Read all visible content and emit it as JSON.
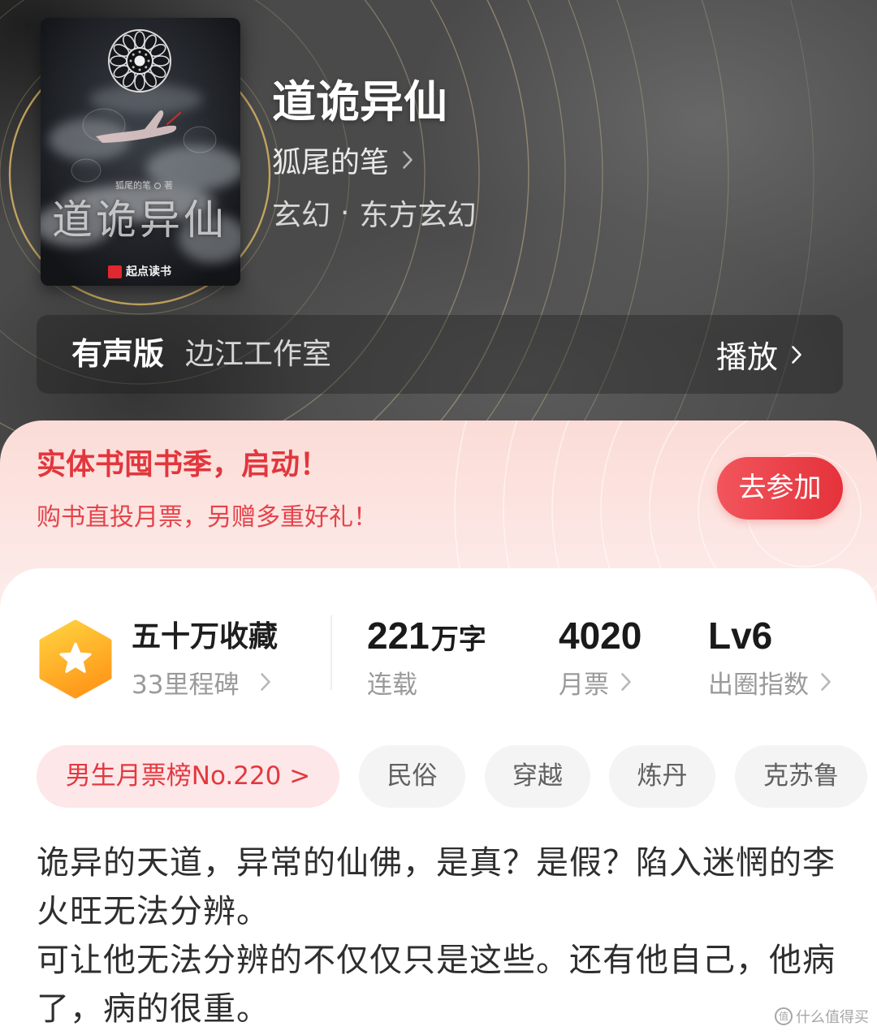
{
  "header": {
    "title": "道诡异仙",
    "author": "狐尾的笔",
    "category": "玄幻",
    "separator": "·",
    "subcategory": "东方玄幻"
  },
  "cover": {
    "author": "狐尾的笔",
    "author_suffix": "著",
    "title": "道诡异仙",
    "publisher": "起点读书"
  },
  "audio": {
    "label": "有声版",
    "studio": "边江工作室",
    "play_label": "播放"
  },
  "promo": {
    "title": "实体书囤书季，启动！",
    "subtitle": "购书直投月票，另赠多重好礼！",
    "button_label": "去参加"
  },
  "stats": {
    "collection": {
      "label": "五十万收藏",
      "sub": "33里程碑"
    },
    "words": {
      "value": "221",
      "unit": "万字",
      "sub": "连载"
    },
    "monthly_tickets": {
      "value": "4020",
      "sub": "月票"
    },
    "influence": {
      "value": "Lv6",
      "sub": "出圈指数"
    }
  },
  "tags": [
    {
      "label": "男生月票榜No.220 >",
      "highlighted": true
    },
    {
      "label": "民俗",
      "highlighted": false
    },
    {
      "label": "穿越",
      "highlighted": false
    },
    {
      "label": "炼丹",
      "highlighted": false
    },
    {
      "label": "克苏鲁",
      "highlighted": false
    }
  ],
  "description": {
    "paragraphs": [
      "诡异的天道，异常的仙佛，是真？是假？陷入迷惘的李火旺无法分辨。",
      "可让他无法分辨的不仅仅只是这些。还有他自己，他病了，病的很重。"
    ]
  },
  "watermark": {
    "badge": "值",
    "text": "什么值得买"
  },
  "theme": {
    "brand_red": "#e5323b",
    "promo_background": "#fce6e3",
    "badge_orange": "#ff9b1c",
    "header_background": "#4a4a4a",
    "ring_gold": "#d6b462"
  },
  "icons": {
    "chevron": "chevron-right-icon",
    "collection_badge": "star-hexagon-icon",
    "cover_emblem": "mandala-emblem"
  }
}
